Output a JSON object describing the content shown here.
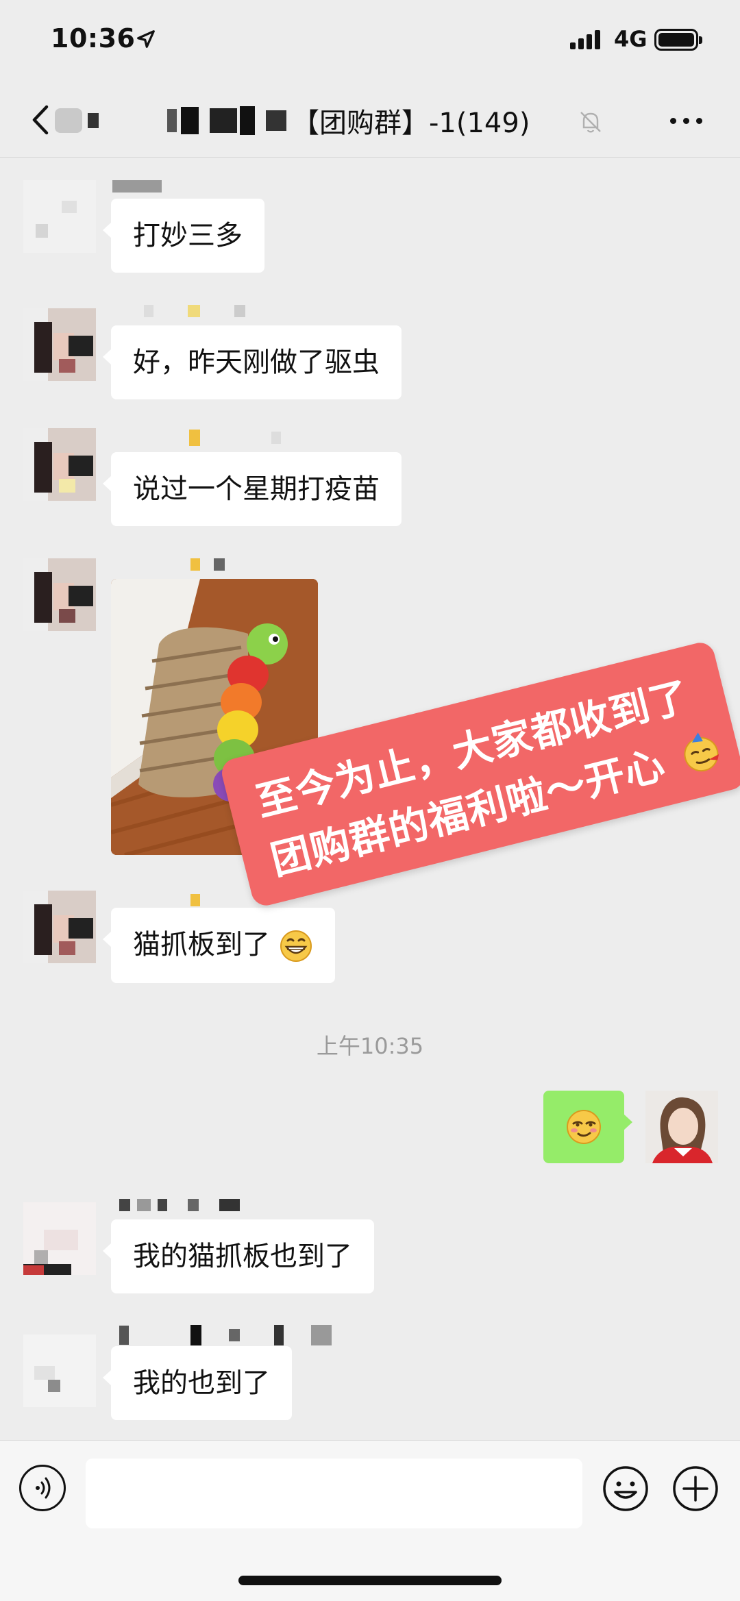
{
  "status": {
    "time": "10:36",
    "network": "4G"
  },
  "header": {
    "title": "【团购群】-1(149)"
  },
  "messages": [
    {
      "text": "打妙三多"
    },
    {
      "text": "好，昨天刚做了驱虫"
    },
    {
      "text": "说过一个星期打疫苗"
    },
    {
      "text": "猫抓板到了"
    },
    {
      "text": "我的猫抓板也到了"
    },
    {
      "text": "我的也到了"
    }
  ],
  "timestamp": "上午10:35",
  "sticker": {
    "line1": "至今为止，大家都收到了",
    "line2": "团购群的福利啦～开心"
  },
  "colors": {
    "sent_bubble": "#95ec69",
    "sticker_bg": "#f26767",
    "background": "#ededed"
  },
  "icons": [
    "location-arrow-icon",
    "signal-icon",
    "battery-icon",
    "back-icon",
    "mute-bell-icon",
    "more-icon",
    "grin-emoji-icon",
    "smirk-emoji-icon",
    "party-emoji-icon",
    "voice-icon",
    "emoji-icon",
    "plus-icon"
  ]
}
